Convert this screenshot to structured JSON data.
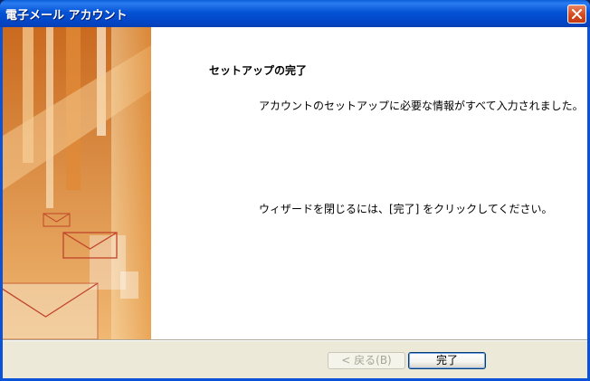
{
  "window": {
    "title": "電子メール アカウント"
  },
  "main": {
    "heading": "セットアップの完了",
    "message1": "アカウントのセットアップに必要な情報がすべて入力されました。",
    "message2": "ウィザードを閉じるには、[完了] をクリックしてください。"
  },
  "buttons": {
    "back_label": "< 戻る(B)",
    "finish_label": "完了"
  },
  "colors": {
    "titlebar": "#0553d6",
    "accent_orange": "#d97c2a",
    "close_button": "#d54a1f"
  },
  "icons": {
    "close": "close-icon",
    "art": "email-envelope-art"
  }
}
